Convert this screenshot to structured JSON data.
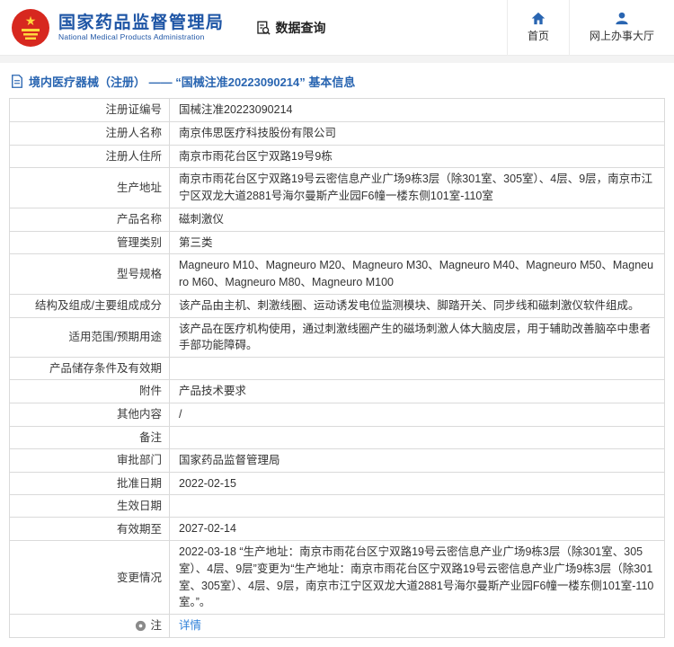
{
  "header": {
    "agency_cn": "国家药品监督管理局",
    "agency_en": "National Medical Products Administration",
    "data_query_label": "数据查询",
    "nav_home_label": "首页",
    "nav_hall_label": "网上办事大厅"
  },
  "icons": {
    "logo": "national-emblem",
    "data_query": "doc-magnifier-icon",
    "home": "home-icon",
    "hall": "person-icon",
    "breadcrumb": "document-icon",
    "note": "note-icon"
  },
  "colors": {
    "brand_blue": "#1e55a5",
    "icon_blue": "#2965b1",
    "link_blue": "#2f80d9",
    "emblem_red": "#d7281f",
    "emblem_gold": "#ffd83d",
    "border_gray": "#dadada"
  },
  "breadcrumb": {
    "text": "境内医疗器械（注册） —— “国械注准20223090214” 基本信息"
  },
  "table": {
    "rows": [
      {
        "label": "注册证编号",
        "value": "国械注准20223090214"
      },
      {
        "label": "注册人名称",
        "value": "南京伟思医疗科技股份有限公司"
      },
      {
        "label": "注册人住所",
        "value": "南京市雨花台区宁双路19号9栋"
      },
      {
        "label": "生产地址",
        "value": "南京市雨花台区宁双路19号云密信息产业广场9栋3层（除301室、305室）、4层、9层，南京市江宁区双龙大道2881号海尔曼斯产业园F6幢一楼东侧101室-110室"
      },
      {
        "label": "产品名称",
        "value": "磁刺激仪"
      },
      {
        "label": "管理类别",
        "value": "第三类"
      },
      {
        "label": "型号规格",
        "value": "Magneuro M10、Magneuro M20、Magneuro M30、Magneuro M40、Magneuro M50、Magneuro M60、Magneuro M80、Magneuro M100"
      },
      {
        "label": "结构及组成/主要组成成分",
        "value": "该产品由主机、刺激线圈、运动诱发电位监测模块、脚踏开关、同步线和磁刺激仪软件组成。"
      },
      {
        "label": "适用范围/预期用途",
        "value": "该产品在医疗机构使用，通过刺激线圈产生的磁场刺激人体大脑皮层，用于辅助改善脑卒中患者手部功能障碍。"
      },
      {
        "label": "产品储存条件及有效期",
        "value": ""
      },
      {
        "label": "附件",
        "value": "产品技术要求"
      },
      {
        "label": "其他内容",
        "value": "/"
      },
      {
        "label": "备注",
        "value": ""
      },
      {
        "label": "审批部门",
        "value": "国家药品监督管理局"
      },
      {
        "label": "批准日期",
        "value": "2022-02-15"
      },
      {
        "label": "生效日期",
        "value": ""
      },
      {
        "label": "有效期至",
        "value": "2027-02-14"
      },
      {
        "label": "变更情况",
        "value": "2022-03-18 “生产地址：南京市雨花台区宁双路19号云密信息产业广场9栋3层（除301室、305室）、4层、9层”变更为“生产地址：南京市雨花台区宁双路19号云密信息产业广场9栋3层（除301室、305室）、4层、9层，南京市江宁区双龙大道2881号海尔曼斯产业园F6幢一楼东侧101室-110室。”。"
      }
    ],
    "note_row": {
      "label": "注",
      "link": "详情"
    }
  }
}
